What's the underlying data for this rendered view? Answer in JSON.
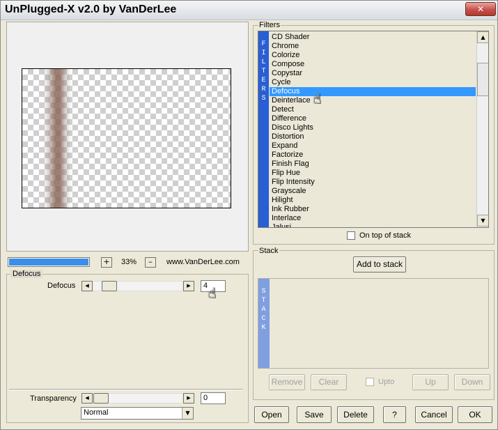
{
  "window": {
    "title": "UnPlugged-X v2.0 by VanDerLee",
    "close_label": "✕"
  },
  "preview": {
    "zoom": "33%",
    "zoom_in_label": "+",
    "zoom_out_label": "–",
    "website": "www.VanDerLee.com",
    "progress_percent": 100
  },
  "filter_panel": {
    "group_title": "Defocus",
    "param_label": "Defocus",
    "param_value": "4",
    "param_slider_fraction": 0.04,
    "left_arrow": "◂",
    "right_arrow": "▸"
  },
  "transparency": {
    "label": "Transparency",
    "value": "0",
    "blend_mode": "Normal",
    "dropdown_arrow": "▼"
  },
  "filters": {
    "group_title": "Filters",
    "strip_letters": [
      "F",
      "I",
      "L",
      "T",
      "E",
      "R",
      "S"
    ],
    "items": [
      "CD Shader",
      "Chrome",
      "Colorize",
      "Compose",
      "Copystar",
      "Cycle",
      "Defocus",
      "Deinterlace",
      "Detect",
      "Difference",
      "Disco Lights",
      "Distortion",
      "Expand",
      "Factorize",
      "Finish Flag",
      "Flip Hue",
      "Flip Intensity",
      "Grayscale",
      "Hilight",
      "Ink Rubber",
      "Interlace",
      "Jalusi"
    ],
    "selected": "Defocus",
    "on_top_label": "On top of stack",
    "scroll_up": "▲",
    "scroll_down": "▼"
  },
  "stack": {
    "group_title": "Stack",
    "add_label": "Add to stack",
    "strip_letters": [
      "S",
      "T",
      "A",
      "C",
      "K"
    ],
    "remove_label": "Remove",
    "clear_label": "Clear",
    "upto_label": "Upto",
    "up_label": "Up",
    "down_label": "Down"
  },
  "footer": {
    "open_label": "Open",
    "save_label": "Save",
    "delete_label": "Delete",
    "help_label": "?",
    "cancel_label": "Cancel",
    "ok_label": "OK"
  },
  "colors": {
    "accent": "#3399ff",
    "filters_strip": "#2a5fd3",
    "stack_strip": "#7f9fe0"
  }
}
